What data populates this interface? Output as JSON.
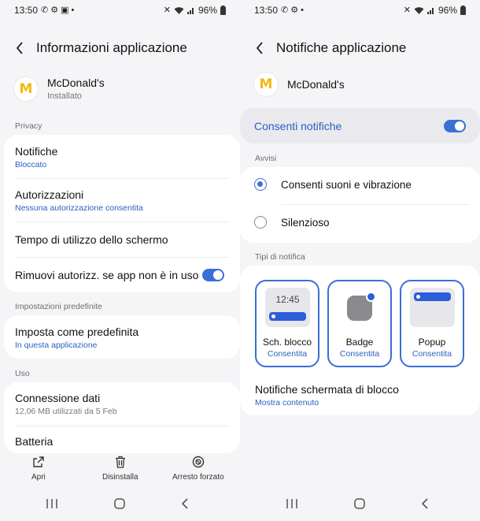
{
  "status": {
    "time": "13:50",
    "battery": "96%"
  },
  "left": {
    "title": "Informazioni applicazione",
    "app": {
      "name": "McDonald's",
      "status": "Installato",
      "logo": "M"
    },
    "privacy_label": "Privacy",
    "notifications": {
      "title": "Notifiche",
      "value": "Bloccato"
    },
    "permissions": {
      "title": "Autorizzazioni",
      "value": "Nessuna autorizzazione consentita"
    },
    "screen_time": {
      "title": "Tempo di utilizzo dello schermo"
    },
    "remove_perms": {
      "title": "Rimuovi autorizz. se app non è in uso",
      "enabled": true
    },
    "defaults_label": "Impostazioni predefinite",
    "set_default": {
      "title": "Imposta come predefinita",
      "value": "In questa applicazione"
    },
    "usage_label": "Uso",
    "data": {
      "title": "Connessione dati",
      "value": "12,06 MB utilizzati da 5 Feb"
    },
    "battery": {
      "title": "Batteria"
    },
    "actions": {
      "open": "Apri",
      "uninstall": "Disinstalla",
      "force_stop": "Arresto forzato"
    }
  },
  "right": {
    "title": "Notifiche applicazione",
    "app": {
      "name": "McDonald's",
      "logo": "M"
    },
    "allow_notifications": {
      "label": "Consenti notifiche",
      "enabled": true
    },
    "alerts_label": "Avvisi",
    "alert_options": [
      {
        "label": "Consenti suoni e vibrazione",
        "selected": true
      },
      {
        "label": "Silenzioso",
        "selected": false
      }
    ],
    "types_label": "Tipi di notifica",
    "types": [
      {
        "title": "Sch. blocco",
        "value": "Consentita",
        "preview_time": "12:45"
      },
      {
        "title": "Badge",
        "value": "Consentita"
      },
      {
        "title": "Popup",
        "value": "Consentita"
      }
    ],
    "lock_screen": {
      "title": "Notifiche schermata di blocco",
      "value": "Mostra contenuto"
    }
  },
  "colors": {
    "accent": "#3b6fd6",
    "link": "#2a60c0",
    "background": "#f5f5f8",
    "logo": "#f2b90f"
  },
  "icons": [
    "whatsapp-icon",
    "gear-icon",
    "image-icon",
    "mute-icon",
    "wifi-icon",
    "signal-icon",
    "battery-icon",
    "back-icon",
    "open-icon",
    "trash-icon",
    "stop-icon",
    "recents-icon",
    "home-icon",
    "nav-back-icon"
  ]
}
